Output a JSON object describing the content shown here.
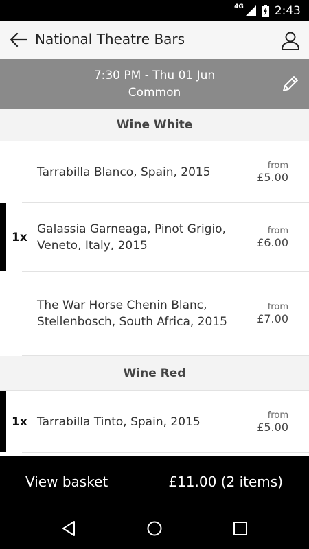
{
  "status_bar": {
    "network": "4G",
    "time": "2:43"
  },
  "app_bar": {
    "title": "National Theatre Bars",
    "back_icon": "arrow-left-icon",
    "account_icon": "user-icon"
  },
  "performance": {
    "datetime": "7:30 PM - Thu 01 Jun",
    "location": "Common",
    "edit_icon": "pencil-icon"
  },
  "sections": [
    {
      "title": "Wine White",
      "items": [
        {
          "name": "Tarrabilla Blanco, Spain, 2015",
          "price_prefix": "from",
          "price": "£5.00",
          "qty": ""
        },
        {
          "name": "Galassia Garneaga, Pinot Grigio, Veneto, Italy, 2015",
          "price_prefix": "from",
          "price": "£6.00",
          "qty": "1x"
        },
        {
          "name": "The War Horse Chenin Blanc, Stellenbosch, South Africa, 2015",
          "price_prefix": "from",
          "price": "£7.00",
          "qty": ""
        }
      ]
    },
    {
      "title": "Wine Red",
      "items": [
        {
          "name": "Tarrabilla Tinto, Spain, 2015",
          "price_prefix": "from",
          "price": "£5.00",
          "qty": "1x"
        }
      ]
    }
  ],
  "basket": {
    "label": "View basket",
    "total": "£11.00 (2 items)"
  },
  "colors": {
    "subheader_bg": "#8a8a8a",
    "accent_bar": "#000000",
    "section_bg": "#f3f3f3"
  }
}
